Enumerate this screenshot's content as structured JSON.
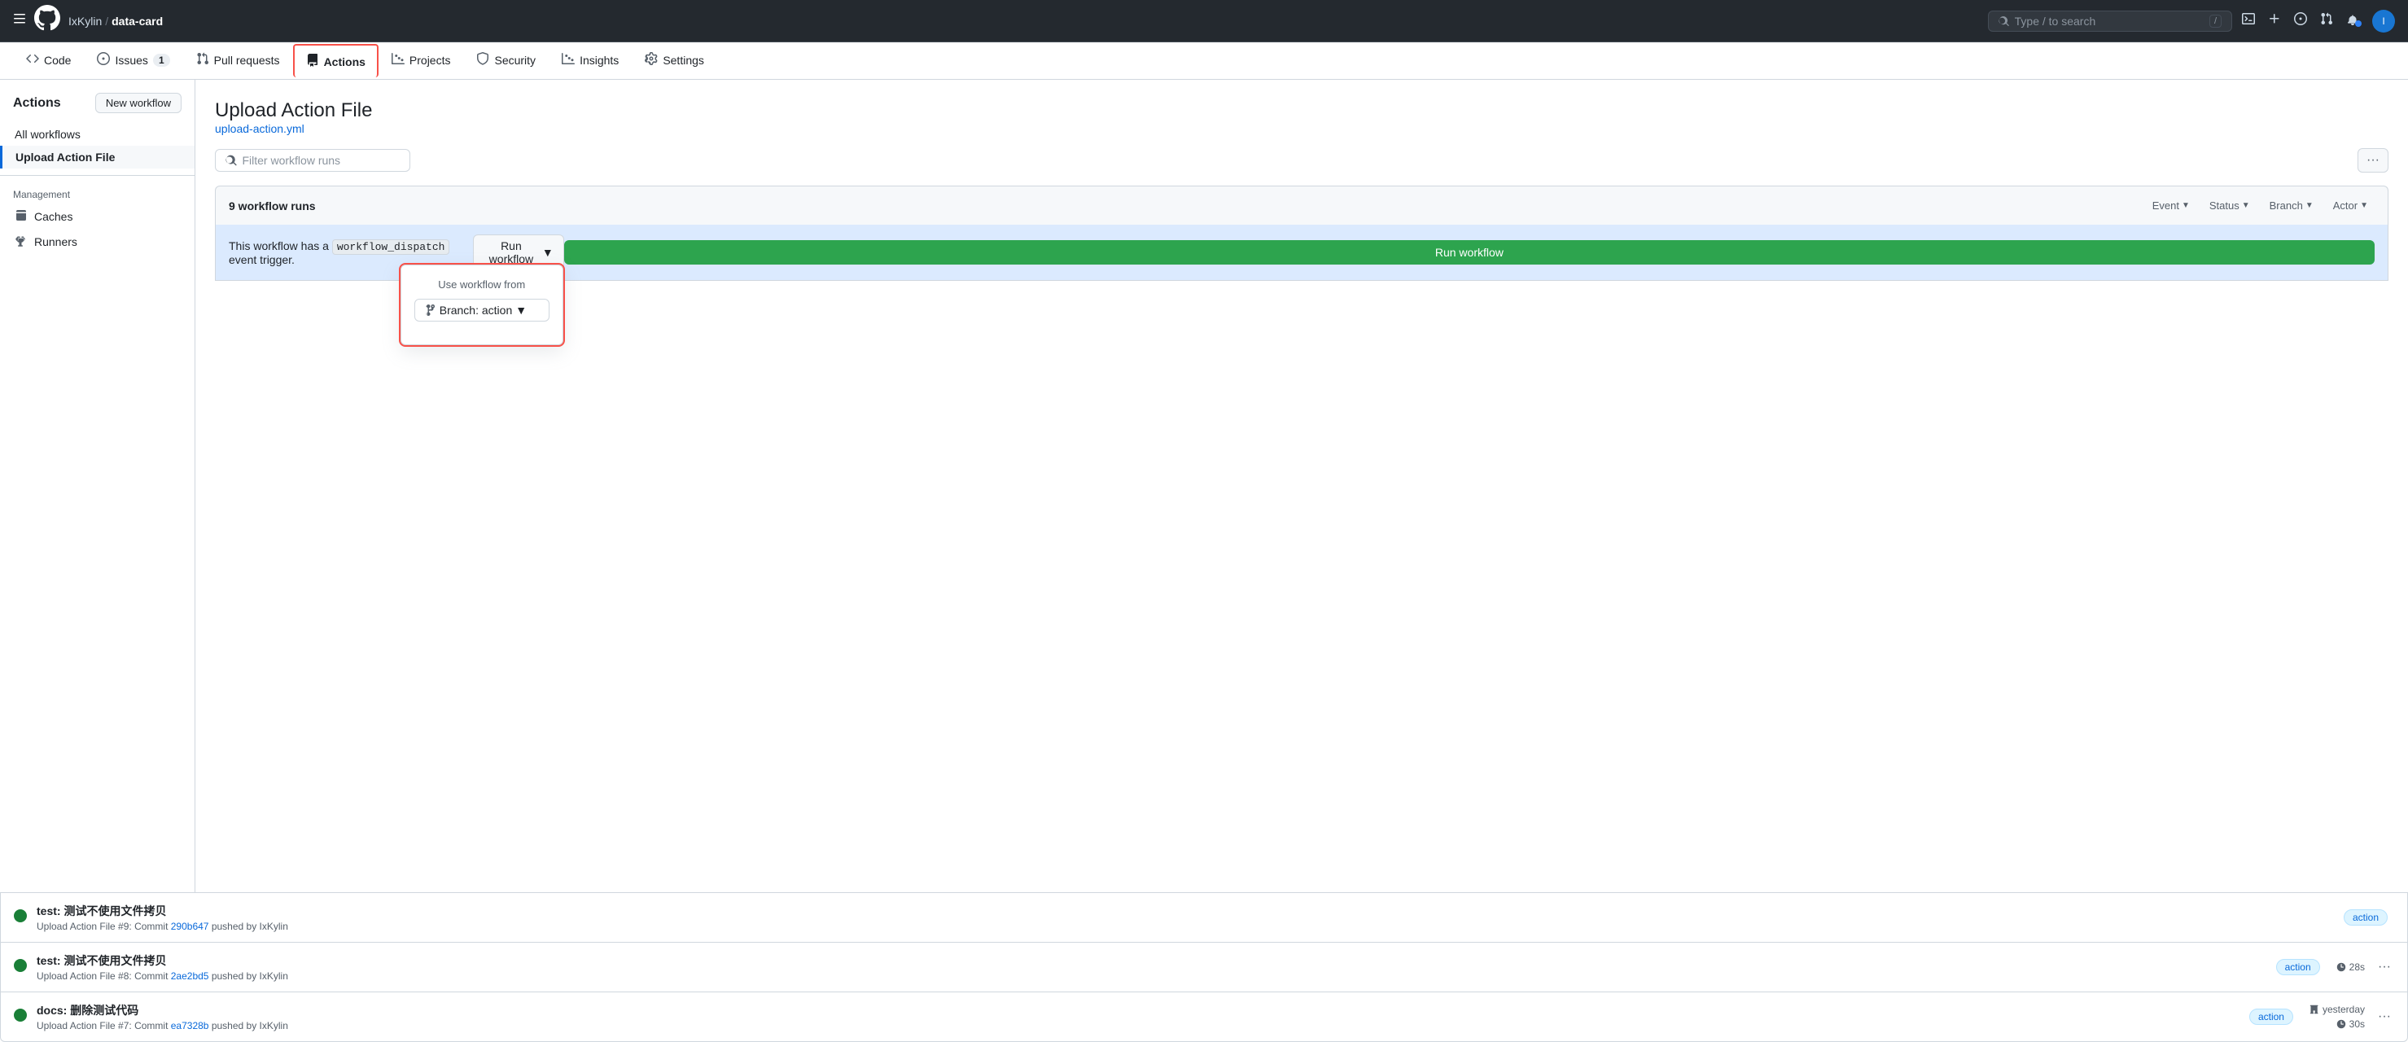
{
  "topnav": {
    "hamburger": "☰",
    "github_logo": "⬤",
    "user": "IxKylin",
    "slash": "/",
    "repo": "data-card",
    "search_placeholder": "Type / to search",
    "search_kbd": "/",
    "actions_plus": "+",
    "terminal_icon": ">_",
    "issues_icon": "⊙",
    "pr_icon": "⇄",
    "notif_icon": "🔔"
  },
  "repo_tabs": [
    {
      "id": "code",
      "icon": "<>",
      "label": "Code",
      "badge": null,
      "active": false
    },
    {
      "id": "issues",
      "icon": "⊙",
      "label": "Issues",
      "badge": "1",
      "active": false
    },
    {
      "id": "pull-requests",
      "icon": "⇄",
      "label": "Pull requests",
      "badge": null,
      "active": false
    },
    {
      "id": "actions",
      "icon": "▶",
      "label": "Actions",
      "badge": null,
      "active": true
    },
    {
      "id": "projects",
      "icon": "⊞",
      "label": "Projects",
      "badge": null,
      "active": false
    },
    {
      "id": "security",
      "icon": "🛡",
      "label": "Security",
      "badge": null,
      "active": false
    },
    {
      "id": "insights",
      "icon": "📈",
      "label": "Insights",
      "badge": null,
      "active": false
    },
    {
      "id": "settings",
      "icon": "⚙",
      "label": "Settings",
      "badge": null,
      "active": false
    }
  ],
  "sidebar": {
    "title": "Actions",
    "new_workflow_label": "New workflow",
    "all_workflows_label": "All workflows",
    "active_workflow_label": "Upload Action File",
    "management_label": "Management",
    "caches_label": "Caches",
    "runners_label": "Runners"
  },
  "content": {
    "workflow_title": "Upload Action File",
    "workflow_file": "upload-action.yml",
    "filter_placeholder": "Filter workflow runs",
    "more_options": "···",
    "runs_count": "9 workflow runs",
    "filter_event": "Event",
    "filter_status": "Status",
    "filter_branch": "Branch",
    "filter_actor": "Actor",
    "dispatch_text_before": "This workflow has a",
    "dispatch_code": "workflow_dispatch",
    "dispatch_text_after": "event trigger.",
    "run_workflow_btn": "Run workflow",
    "run_workflow_dropdown": {
      "title": "Use workflow from",
      "branch_label": "Branch: action",
      "confirm_btn": "Run workflow"
    }
  },
  "runs": [
    {
      "id": "run1",
      "status": "success",
      "title": "test: 测试不使用文件拷贝",
      "subtitle_prefix": "Upload Action File #9: Commit",
      "commit": "290b647",
      "subtitle_suffix": "pushed by IxKylin",
      "tag": "action",
      "time_label": null,
      "duration": null
    },
    {
      "id": "run2",
      "status": "success",
      "title": "test: 测试不使用文件拷贝",
      "subtitle_prefix": "Upload Action File #8: Commit",
      "commit": "2ae2bd5",
      "subtitle_suffix": "pushed by IxKylin",
      "tag": "action",
      "time_label": "28s",
      "duration": "28s"
    },
    {
      "id": "run3",
      "status": "success",
      "title": "docs: 删除测试代码",
      "subtitle_prefix": "Upload Action File #7: Commit",
      "commit": "ea7328b",
      "subtitle_suffix": "pushed by IxKylin",
      "tag": "action",
      "time_label": "yesterday",
      "duration": "30s"
    }
  ]
}
